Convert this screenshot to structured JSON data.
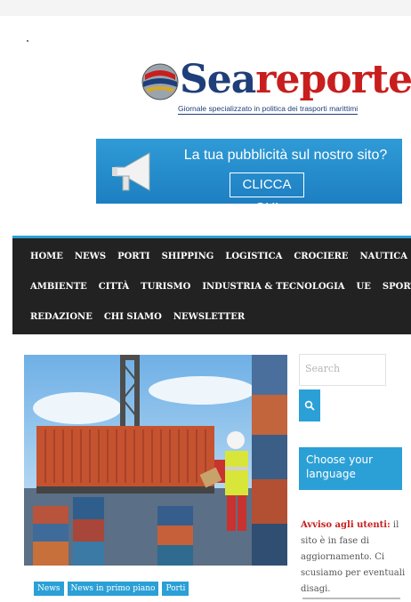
{
  "site": {
    "logo_sea": "Sea",
    "logo_reporter": "reporter",
    "tagline": "Giornale specializzato in politica dei trasporti marittimi"
  },
  "banner": {
    "text": "La tua pubblicità sul nostro sito?",
    "button": "CLICCA QUI"
  },
  "nav": {
    "row1": [
      "HOME",
      "NEWS",
      "PORTI",
      "SHIPPING",
      "LOGISTICA",
      "CROCIERE",
      "NAUTICA"
    ],
    "row2": [
      "AMBIENTE",
      "CITTÀ",
      "TURISMO",
      "INDUSTRIA & TECNOLOGIA",
      "UE",
      "SPORT"
    ],
    "row3": [
      "REDAZIONE",
      "CHI SIAMO",
      "NEWSLETTER"
    ]
  },
  "article": {
    "tags": [
      "News",
      "News in primo piano",
      "Porti"
    ]
  },
  "sidebar": {
    "search_placeholder": "Search",
    "language_label": "Choose your language",
    "notice_title": "Avviso agli utenti:",
    "notice_text": " il sito è in fase di aggiornamento. Ci scusiamo per eventuali disagi."
  },
  "colors": {
    "accent": "#2ba0d6",
    "nav_bg": "#222222",
    "brand_blue": "#1f3f7a",
    "brand_red": "#c81e1e"
  }
}
